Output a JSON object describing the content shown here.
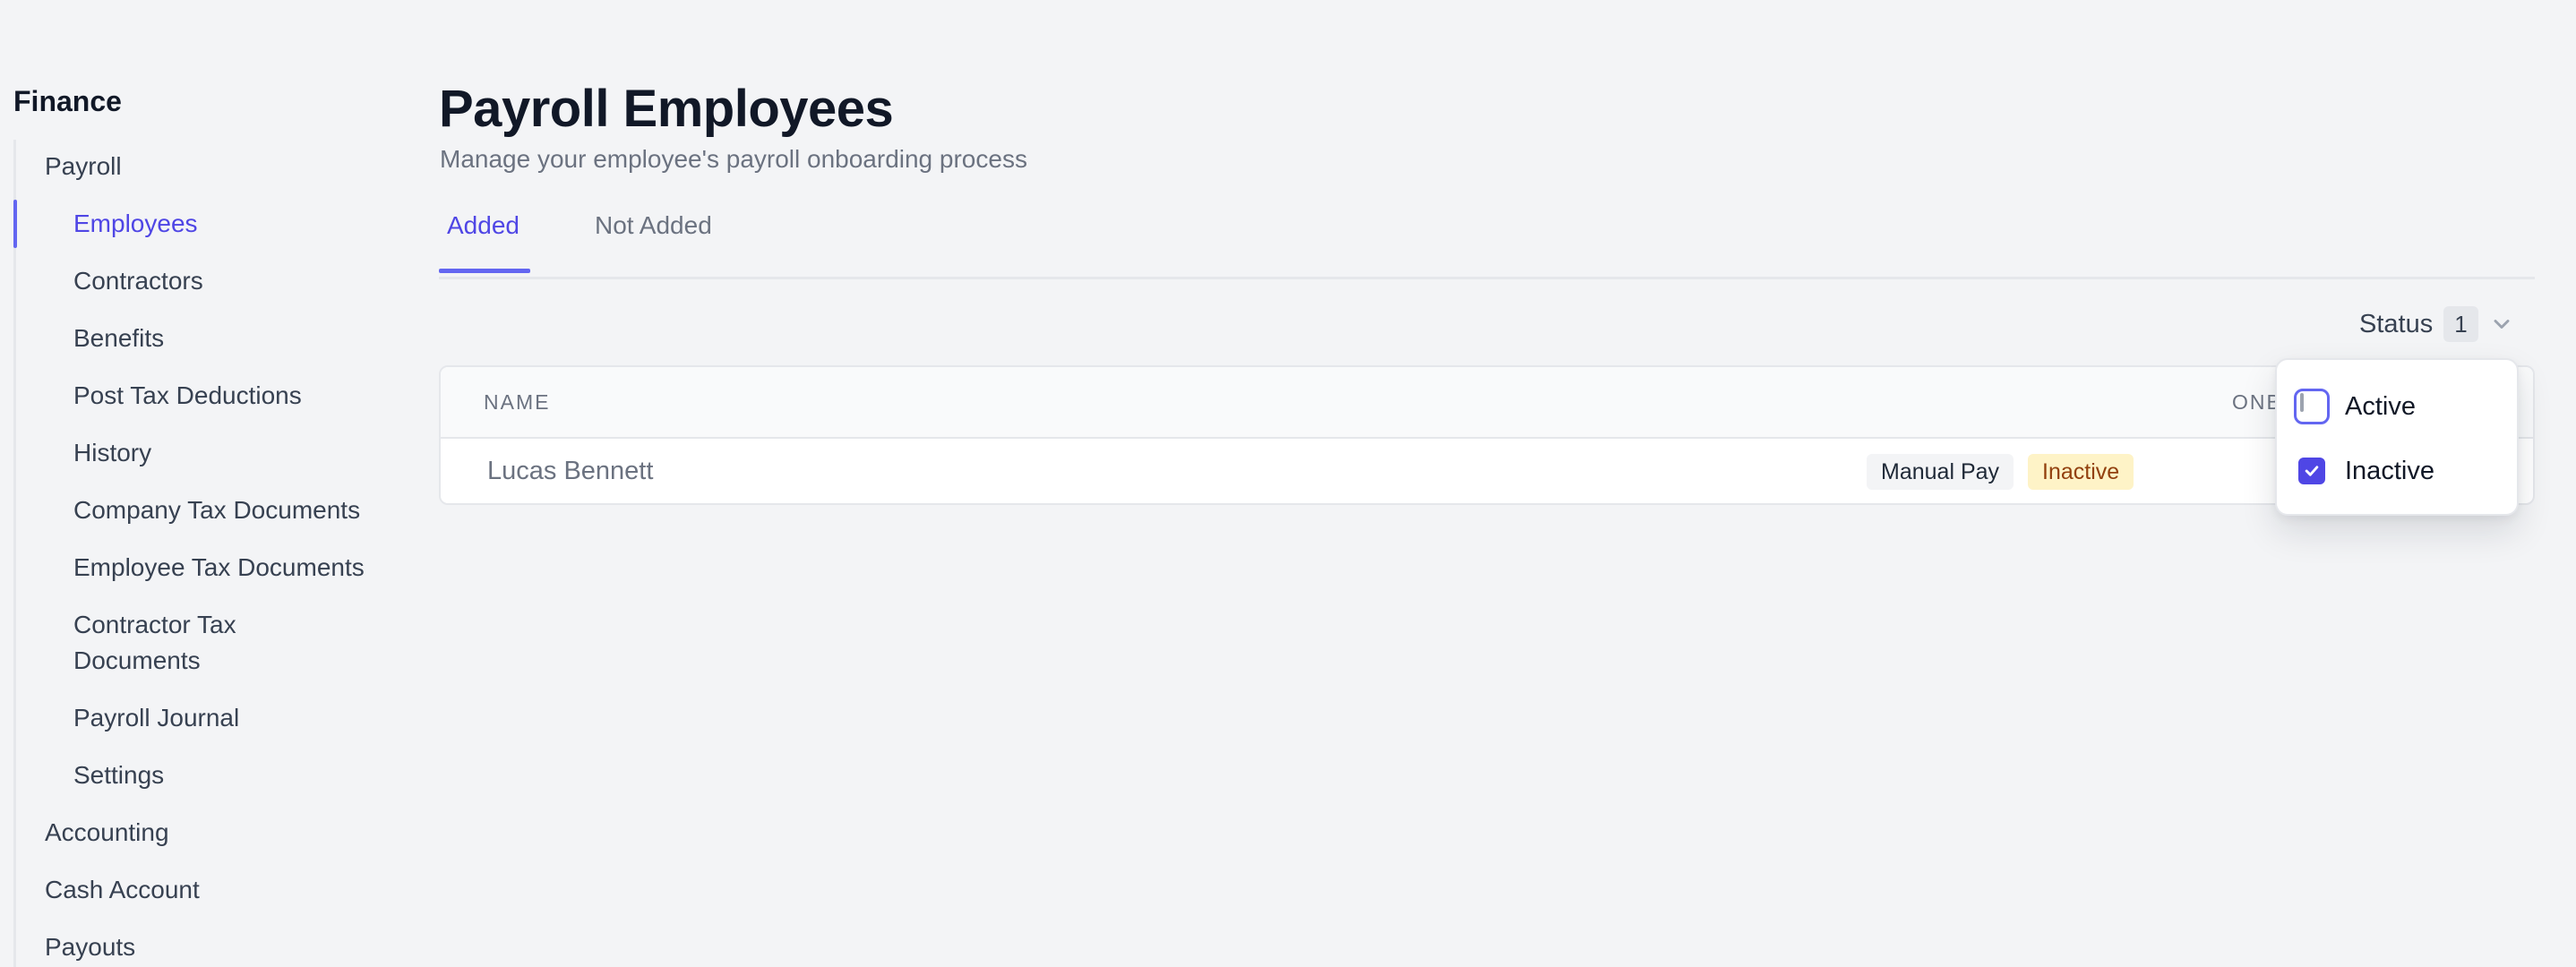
{
  "sidebar": {
    "title": "Finance",
    "items": [
      {
        "label": "Payroll"
      },
      {
        "label": "Employees"
      },
      {
        "label": "Contractors"
      },
      {
        "label": "Benefits"
      },
      {
        "label": "Post Tax Deductions"
      },
      {
        "label": "History"
      },
      {
        "label": "Company Tax Documents"
      },
      {
        "label": "Employee Tax Documents"
      },
      {
        "label": "Contractor Tax"
      },
      {
        "label": "Documents"
      },
      {
        "label": "Payroll Journal"
      },
      {
        "label": "Settings"
      },
      {
        "label": "Accounting"
      },
      {
        "label": "Cash Account"
      },
      {
        "label": "Payouts"
      }
    ]
  },
  "header": {
    "title": "Payroll Employees",
    "subtitle": "Manage your employee's payroll onboarding process"
  },
  "tabs": [
    {
      "label": "Added"
    },
    {
      "label": "Not Added"
    }
  ],
  "filter": {
    "label": "Status",
    "count": "1",
    "icon": "chevron-down-icon"
  },
  "table": {
    "columns": [
      "NAME",
      "ONB"
    ],
    "rows": [
      {
        "name": "Lucas Bennett",
        "badges": [
          "Manual Pay",
          "Inactive"
        ]
      }
    ]
  },
  "dropdown": {
    "options": [
      {
        "label": "Active",
        "checked": false
      },
      {
        "label": "Inactive",
        "checked": true
      }
    ]
  },
  "colors": {
    "accent": "#4f46e5",
    "inactive_badge_bg": "#fef3c7",
    "inactive_badge_text": "#92400e"
  }
}
